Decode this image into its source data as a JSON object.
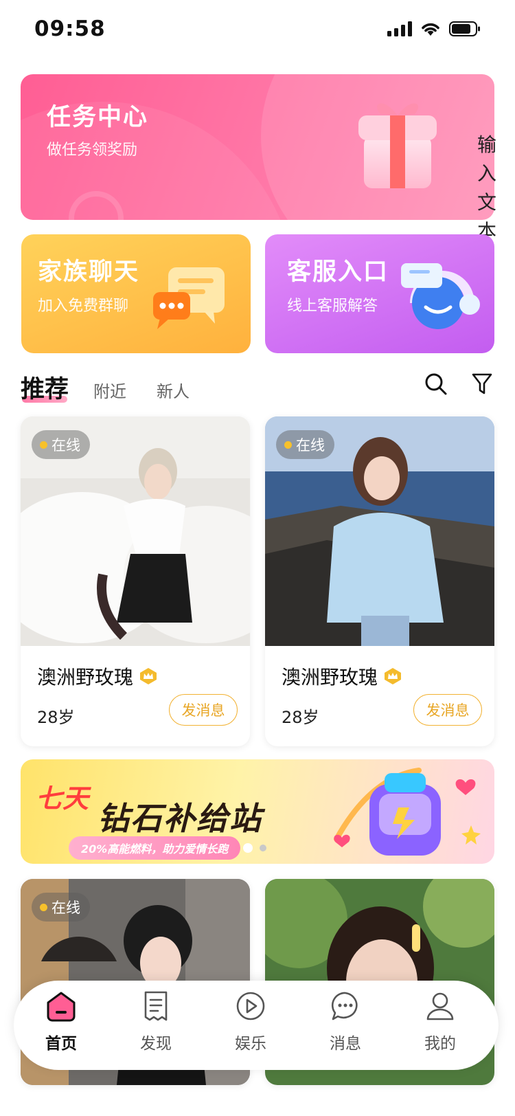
{
  "status_bar": {
    "time": "09:58"
  },
  "task_card": {
    "title": "任务中心",
    "subtitle": "做任务领奖励"
  },
  "side_text": "输入文本",
  "family_card": {
    "title": "家族聊天",
    "subtitle": "加入免费群聊"
  },
  "service_card": {
    "title": "客服入口",
    "subtitle": "线上客服解答"
  },
  "tabs": [
    {
      "label": "推荐"
    },
    {
      "label": "附近"
    },
    {
      "label": "新人"
    }
  ],
  "profiles": [
    {
      "status": "在线",
      "name": "澳洲野玫瑰",
      "age": "28岁",
      "button": "发消息"
    },
    {
      "status": "在线",
      "name": "澳洲野玫瑰",
      "age": "28岁",
      "button": "发消息"
    },
    {
      "status": "在线"
    },
    {}
  ],
  "banner": {
    "line1": "七天",
    "line2": "钻石补给站",
    "slogan": "20%高能燃料，助力爱情长跑"
  },
  "bottom_nav": [
    {
      "label": "首页",
      "icon": "home-icon",
      "active": true
    },
    {
      "label": "发现",
      "icon": "document-icon"
    },
    {
      "label": "娱乐",
      "icon": "play-icon"
    },
    {
      "label": "消息",
      "icon": "chat-icon"
    },
    {
      "label": "我的",
      "icon": "user-icon"
    }
  ],
  "colors": {
    "accent_pink": "#ff5e94",
    "online_dot": "#f7c12b",
    "message_button": "#e8a625"
  }
}
